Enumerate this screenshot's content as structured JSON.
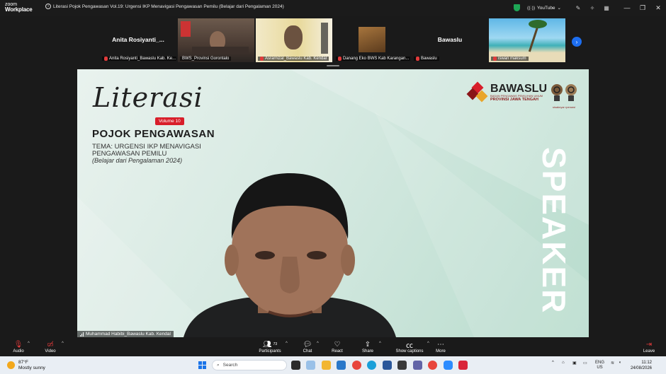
{
  "app": {
    "logo_line1": "zoom",
    "logo_line2": "Workplace",
    "meeting_title": "Literasi Pojok Pengawasan Vol.19: Urgensi IKP Menavigasi Pengawasan Pemilu (Belajar  dari Pengalaman 2024)",
    "youtube_label": "YouTube"
  },
  "participants_strip": [
    {
      "display": "Anita  Rosiyanti_...",
      "label": "Anita Rosiyanti_Bawaslu Kab. Ke..."
    },
    {
      "display": "",
      "label": "BWS_Provinsi Gorontalo"
    },
    {
      "display": "",
      "label": "Asrarnizal_Bawaslu Kab. Kendal"
    },
    {
      "display": "",
      "label": "Danang Eko BWS Kab Karangan..."
    },
    {
      "display": "Bawaslu",
      "label": "Bawaslu"
    },
    {
      "display": "",
      "label": "iswan maksum"
    }
  ],
  "main_video": {
    "slide_title": "Literasi",
    "volume_badge": "Volume 10",
    "program_name": "POJOK PENGAWASAN",
    "theme_line1": "TEMA: URGENSI IKP MENAVIGASI",
    "theme_line2": "PENGAWASAN PEMILU",
    "theme_line3": "(Belajar dari Pengalaman 2024)",
    "org_name": "BAWASLU",
    "org_sub": "BADAN PENGAWAS PEMILIHAN UMUM",
    "org_province": "PROVINSI JAWA TENGAH",
    "mascot_caption": "sisaknyar rpenawi",
    "vertical_text": "SPEAKER",
    "speaker_name": "Muhammad Habibi_Bawaslu Kab. Kendal"
  },
  "toolbar": {
    "audio": "Audio",
    "video": "Video",
    "participants": "Participants",
    "participants_count": "73",
    "chat": "Chat",
    "react": "React",
    "share": "Share",
    "captions": "Show captions",
    "more": "More",
    "leave": "Leave"
  },
  "taskbar": {
    "temperature": "87°F",
    "weather": "Mostly sunny",
    "search_placeholder": "Search",
    "lang1": "ENG",
    "lang2": "US",
    "time": "11:12",
    "date": "24/08/2026"
  },
  "colors": {
    "accent_blue": "#1d6ef0",
    "bawaslu_red": "#d81e2a",
    "stage_green": "#b8dccd"
  }
}
